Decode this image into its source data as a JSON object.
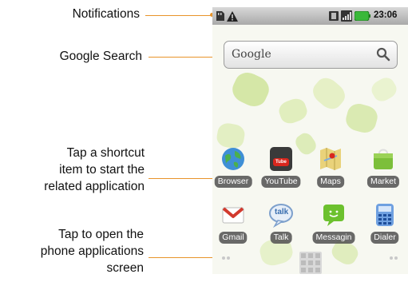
{
  "callouts": {
    "notifications": "Notifications",
    "google_search": "Google Search",
    "shortcut": [
      "Tap a shortcut",
      "item to start the",
      "related application"
    ],
    "apps": [
      "Tap to open the",
      "phone applications",
      "screen"
    ]
  },
  "status_bar": {
    "time": "23:06"
  },
  "search": {
    "label": "Google"
  },
  "apps": [
    {
      "label": "Browser",
      "icon": "globe-icon"
    },
    {
      "label": "YouTube",
      "icon": "youtube-icon",
      "badge": "Tube"
    },
    {
      "label": "Maps",
      "icon": "map-icon"
    },
    {
      "label": "Market",
      "icon": "market-bag-icon"
    },
    {
      "label": "Gmail",
      "icon": "gmail-envelope-icon"
    },
    {
      "label": "Talk",
      "icon": "talk-bubble-icon",
      "badge": "talk"
    },
    {
      "label": "Messagin",
      "icon": "sms-icon"
    },
    {
      "label": "Dialer",
      "icon": "dialer-icon"
    }
  ],
  "colors": {
    "accent": "#e8942a",
    "battery": "#3ab83a",
    "label_bg": "#505050"
  }
}
